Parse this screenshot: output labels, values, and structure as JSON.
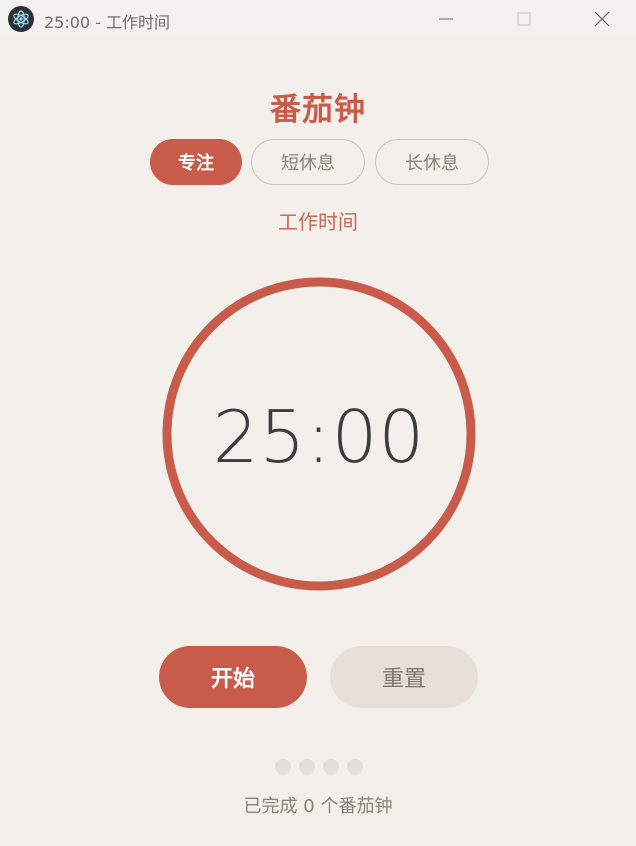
{
  "window": {
    "title": "25:00 - 工作时间",
    "app_icon": "electron-atom-icon"
  },
  "app": {
    "title": "番茄钟"
  },
  "modes": [
    {
      "label": "专注",
      "active": true
    },
    {
      "label": "短休息",
      "active": false
    },
    {
      "label": "长休息",
      "active": false
    }
  ],
  "mode_label": "工作时间",
  "timer": {
    "display": "25:00",
    "progress": 1.0
  },
  "actions": {
    "start_label": "开始",
    "reset_label": "重置"
  },
  "session_dots": {
    "total": 4,
    "filled": 0
  },
  "completed_text": "已完成 0 个番茄钟",
  "colors": {
    "accent": "#c95b4a",
    "background": "#f3efea",
    "secondary_button": "#e7e0da",
    "dot_empty": "#e4dfd9"
  }
}
